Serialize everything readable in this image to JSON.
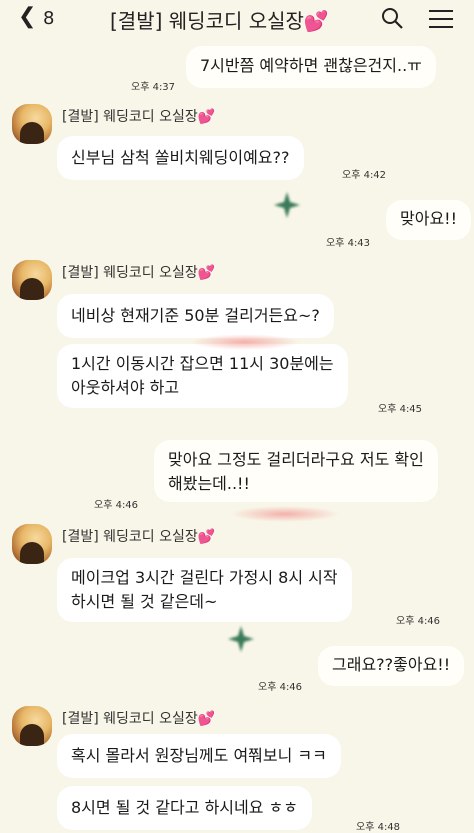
{
  "header": {
    "back_count": "8",
    "title": "[결발] 웨딩코디 오실장💕"
  },
  "messages": [
    {
      "text": "7시반쯤 예약하면 괜찮은건지..ㅠ",
      "time": "오후 4:37"
    },
    {
      "sender": "[결발] 웨딩코디 오실장",
      "text": "신부님 삼척 쏠비치웨딩이예요??",
      "time": "오후 4:42"
    },
    {
      "text": "맞아요!!",
      "time": "오후 4:43"
    },
    {
      "sender": "[결발] 웨딩코디 오실장",
      "text": "네비상 현재기준 50분 걸리거든요~?"
    },
    {
      "line1": "1시간 이동시간 잡으면 11시 30분에는",
      "line2": "아웃하셔야 하고",
      "time": "오후 4:45"
    },
    {
      "line1": "맞아요 그정도 걸리더라구요 저도 확인",
      "line2": "해봤는데..!!",
      "time": "오후 4:46"
    },
    {
      "sender": "[결발] 웨딩코디 오실장",
      "line1": "메이크업 3시간 걸린다 가정시 8시 시작",
      "line2": "하시면 될 것 같은데~",
      "time": "오후 4:46"
    },
    {
      "text": "그래요??좋아요!!",
      "time": "오후 4:46"
    },
    {
      "sender": "[결발] 웨딩코디 오실장",
      "text": "혹시 몰라서 원장님께도 여쭤보니 ㅋㅋ"
    },
    {
      "text": "8시면 될 것 같다고 하시네요 ㅎㅎ",
      "time": "오후 4:48"
    }
  ]
}
